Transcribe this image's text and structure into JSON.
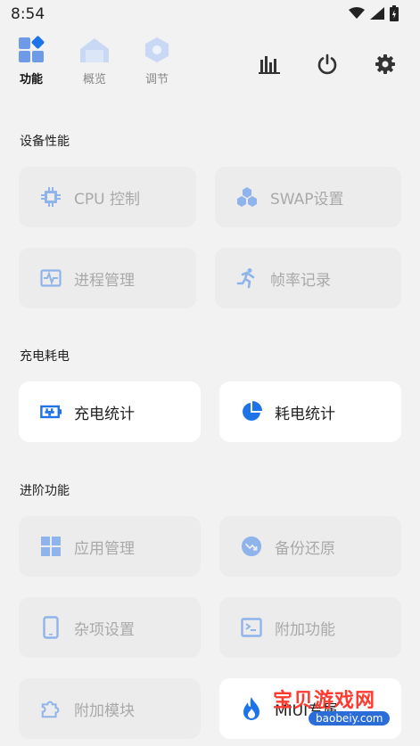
{
  "status_bar": {
    "time": "8:54"
  },
  "top_nav": {
    "tabs": [
      {
        "label": "功能",
        "active": true
      },
      {
        "label": "概览",
        "active": false
      },
      {
        "label": "调节",
        "active": false
      }
    ]
  },
  "sections": [
    {
      "title": "设备性能",
      "cards": [
        {
          "label": "CPU 控制",
          "icon": "chip-icon",
          "enabled": false
        },
        {
          "label": "SWAP设置",
          "icon": "hexagons-icon",
          "enabled": false
        },
        {
          "label": "进程管理",
          "icon": "activity-icon",
          "enabled": false
        },
        {
          "label": "帧率记录",
          "icon": "running-icon",
          "enabled": false
        }
      ]
    },
    {
      "title": "充电耗电",
      "cards": [
        {
          "label": "充电统计",
          "icon": "battery-charging-icon",
          "enabled": true
        },
        {
          "label": "耗电统计",
          "icon": "pie-chart-icon",
          "enabled": true
        }
      ]
    },
    {
      "title": "进阶功能",
      "cards": [
        {
          "label": "应用管理",
          "icon": "grid-icon",
          "enabled": false
        },
        {
          "label": "备份还原",
          "icon": "restore-icon",
          "enabled": false
        },
        {
          "label": "杂项设置",
          "icon": "phone-icon",
          "enabled": false
        },
        {
          "label": "附加功能",
          "icon": "terminal-icon",
          "enabled": false
        },
        {
          "label": "附加模块",
          "icon": "puzzle-icon",
          "enabled": false
        },
        {
          "label": "MIUI专属",
          "icon": "flame-icon",
          "enabled": true
        }
      ]
    }
  ],
  "watermark": {
    "text": "宝贝游戏网",
    "url": "baobeiy.com"
  },
  "colors": {
    "accent": "#1e73e8",
    "disabled_icon": "#8fb4ec",
    "background": "#f2f2f2"
  }
}
